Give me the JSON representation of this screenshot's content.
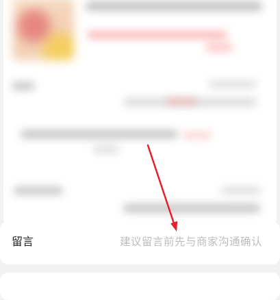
{
  "message": {
    "label": "留言",
    "placeholder": "建议留言前先与商家沟通确认"
  },
  "colors": {
    "page_bg": "#f2f2f2",
    "card_bg": "#ffffff",
    "label_text": "#222222",
    "placeholder_text": "#bdbdbd",
    "annotation_arrow": "#e5202b"
  },
  "icons": {
    "annotation": "arrow-annotation-icon"
  }
}
